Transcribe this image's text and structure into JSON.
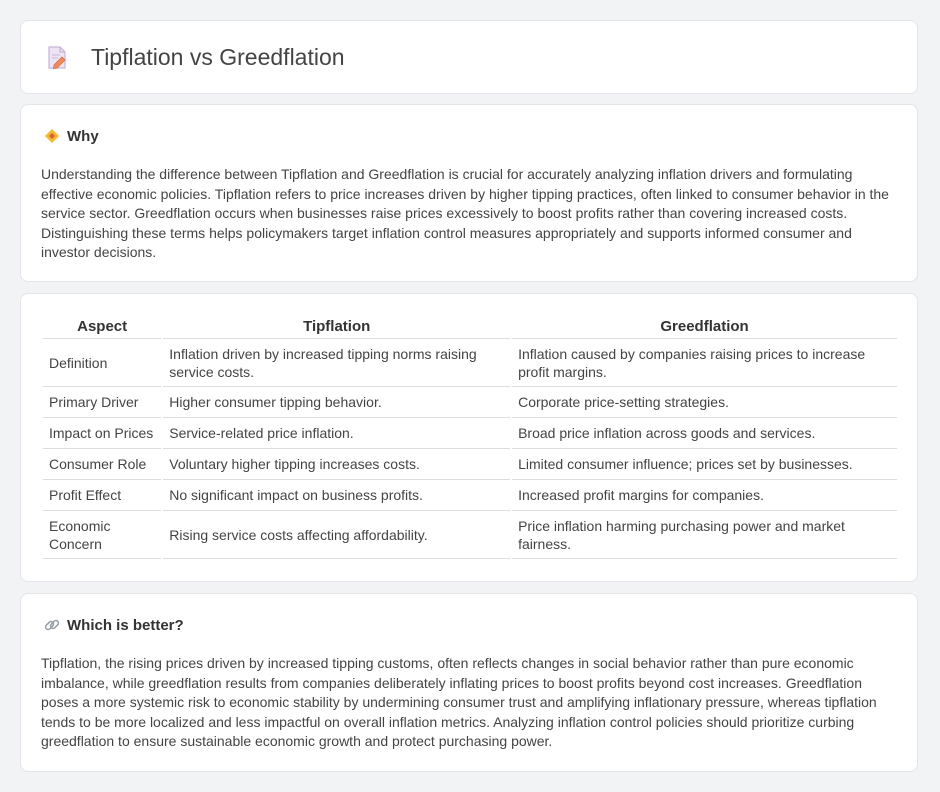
{
  "header": {
    "title": "Tipflation vs Greedflation",
    "icon": "document-pencil-icon"
  },
  "why": {
    "heading": "Why",
    "icon": "diamond-icon",
    "text": "Understanding the difference between Tipflation and Greedflation is crucial for accurately analyzing inflation drivers and formulating effective economic policies. Tipflation refers to price increases driven by higher tipping practices, often linked to consumer behavior in the service sector. Greedflation occurs when businesses raise prices excessively to boost profits rather than covering increased costs. Distinguishing these terms helps policymakers target inflation control measures appropriately and supports informed consumer and investor decisions."
  },
  "table": {
    "headers": [
      "Aspect",
      "Tipflation",
      "Greedflation"
    ],
    "rows": [
      [
        "Definition",
        "Inflation driven by increased tipping norms raising service costs.",
        "Inflation caused by companies raising prices to increase profit margins."
      ],
      [
        "Primary Driver",
        "Higher consumer tipping behavior.",
        "Corporate price-setting strategies."
      ],
      [
        "Impact on Prices",
        "Service-related price inflation.",
        "Broad price inflation across goods and services."
      ],
      [
        "Consumer Role",
        "Voluntary higher tipping increases costs.",
        "Limited consumer influence; prices set by businesses."
      ],
      [
        "Profit Effect",
        "No significant impact on business profits.",
        "Increased profit margins for companies."
      ],
      [
        "Economic Concern",
        "Rising service costs affecting affordability.",
        "Price inflation harming purchasing power and market fairness."
      ]
    ]
  },
  "better": {
    "heading": "Which is better?",
    "icon": "link-icon",
    "text": "Tipflation, the rising prices driven by increased tipping customs, often reflects changes in social behavior rather than pure economic imbalance, while greedflation results from companies deliberately inflating prices to boost profits beyond cost increases. Greedflation poses a more systemic risk to economic stability by undermining consumer trust and amplifying inflationary pressure, whereas tipflation tends to be more localized and less impactful on overall inflation metrics. Analyzing inflation control policies should prioritize curbing greedflation to ensure sustainable economic growth and protect purchasing power."
  }
}
